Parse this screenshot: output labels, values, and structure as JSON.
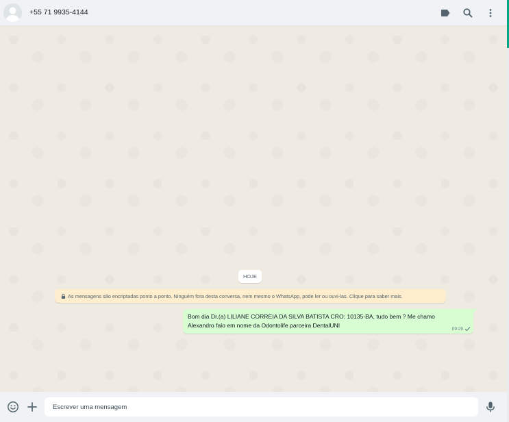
{
  "header": {
    "contact_name": "+55 71 9935-4144",
    "icons": [
      "label-icon",
      "search-icon",
      "menu-icon"
    ]
  },
  "chat": {
    "date_chip": "HOJE",
    "encryption_notice": "As mensagens são encriptadas ponto a ponto. Ninguém fora desta conversa, nem mesmo o WhatsApp, pode ler ou ouvi-las. Clique para saber mais.",
    "messages": [
      {
        "direction": "outgoing",
        "text": "Bom dia Dr.(a) LILIANE CORREIA DA SILVA BATISTA CRO: 10135-BA, tudo bem ? Me chamo Alexandro falo em nome da Odontolife parceira DentalUNI",
        "time": "09:29",
        "status": "sent"
      }
    ]
  },
  "footer": {
    "placeholder": "Escrever uma mensagem",
    "value": ""
  },
  "colors": {
    "header_bg": "#f0f2f5",
    "chat_bg": "#efeae2",
    "outgoing_bubble": "#d9fdd3",
    "notice_bg": "#ffeecd",
    "accent": "#00a884"
  }
}
